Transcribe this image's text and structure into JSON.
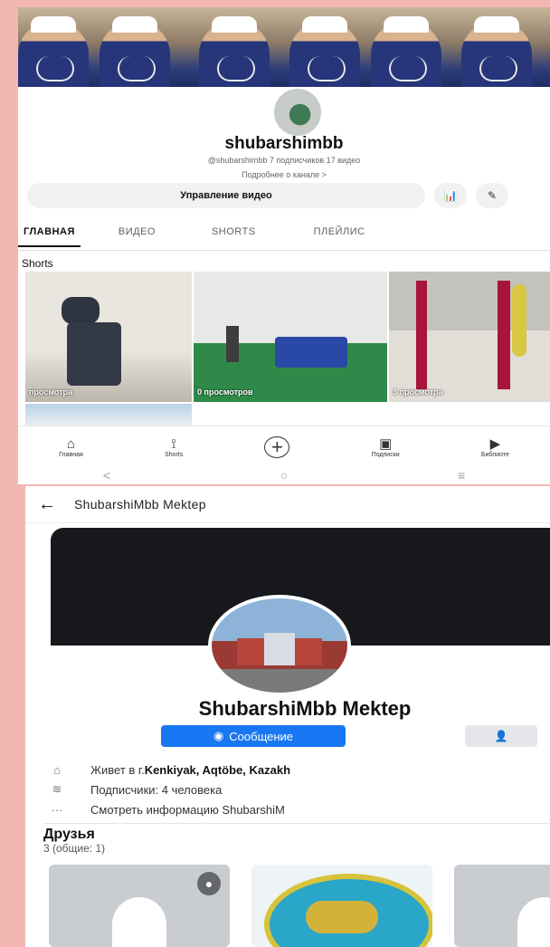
{
  "youtube": {
    "channel_name": "shubarshimbb",
    "meta": "@shubarshimbb  7 подписчиков  17 видео",
    "about": "Подробнее о канале  >",
    "manage_label": "Управление видео",
    "tabs": [
      {
        "label": "ГЛАВНАЯ",
        "active": true
      },
      {
        "label": "ВИДЕО"
      },
      {
        "label": "SHORTS"
      },
      {
        "label": "ПЛЕЙЛИС"
      }
    ],
    "shorts_title": "Shorts",
    "shorts": [
      {
        "views": "просмотра"
      },
      {
        "views": "0 просмотров"
      },
      {
        "views": "3 просмотра"
      }
    ],
    "nav": [
      {
        "icon": "home-icon",
        "label": "Главная"
      },
      {
        "icon": "shorts-icon",
        "label": "Shorts"
      },
      {
        "icon": "add-icon",
        "label": ""
      },
      {
        "icon": "subscriptions-icon",
        "label": "Подписки"
      },
      {
        "icon": "library-icon",
        "label": "Библиоте"
      }
    ]
  },
  "facebook": {
    "header_title": "ShubarshiMbb Mektep",
    "name": "ShubarshiMbb Mektep",
    "message_label": "Сообщение",
    "info": {
      "lives_prefix": "Живет в г. ",
      "lives_city": "Kenkiyak, Aqtöbe, Kazakh",
      "followers": "Подписчики: 4 человека",
      "see_info": "Смотреть информацию ShubarshiM"
    },
    "friends_title": "Друзья",
    "friends_count": "3 (общие: 1)"
  },
  "colors": {
    "background": "#f2b7b1",
    "fb_blue": "#1877f2",
    "yt_uniform": "#27367a"
  }
}
